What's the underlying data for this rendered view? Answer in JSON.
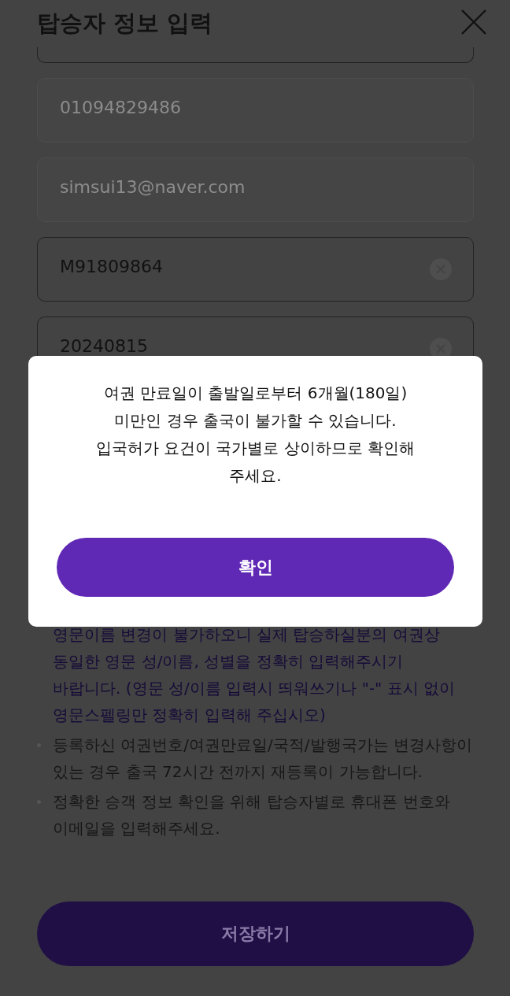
{
  "header": {
    "title": "탑승자 정보 입력"
  },
  "fields": [
    {
      "value": "01094829486",
      "disabled": true,
      "clearable": false
    },
    {
      "value": "simsui13@naver.com",
      "disabled": true,
      "clearable": false
    },
    {
      "value": "M91809864",
      "disabled": false,
      "clearable": true
    },
    {
      "value": "20240815",
      "disabled": false,
      "clearable": true
    }
  ],
  "notes": [
    {
      "kind": "warning",
      "text": "영문이름 변경이 불가하오니 실제 탑승하실분의 여권상 동일한 영문 성/이름, 성별을 정확히 입력해주시기 바랍니다. (영문 성/이름 입력시 띄워쓰기나 \"-\" 표시 없이 영문스펠링만 정확히 입력해 주십시오)"
    },
    {
      "kind": "info",
      "text": "등록하신 여권번호/여권만료일/국적/발행국가는 변경사항이 있는 경우 출국 72시간 전까지 재등록이 가능합니다."
    },
    {
      "kind": "info",
      "text": "정확한 승객 정보 확인을 위해 탑승자별로 휴대폰 번호와 이메일을 입력해주세요."
    }
  ],
  "save_button": "저장하기",
  "dialog": {
    "lines": [
      "여권 만료일이 출발일로부터 6개월(180일)",
      "미만인 경우 출국이 불가할 수 있습니다.",
      "입국허가 요건이 국가별로 상이하므로 확인해",
      "주세요."
    ],
    "button": "확인"
  }
}
